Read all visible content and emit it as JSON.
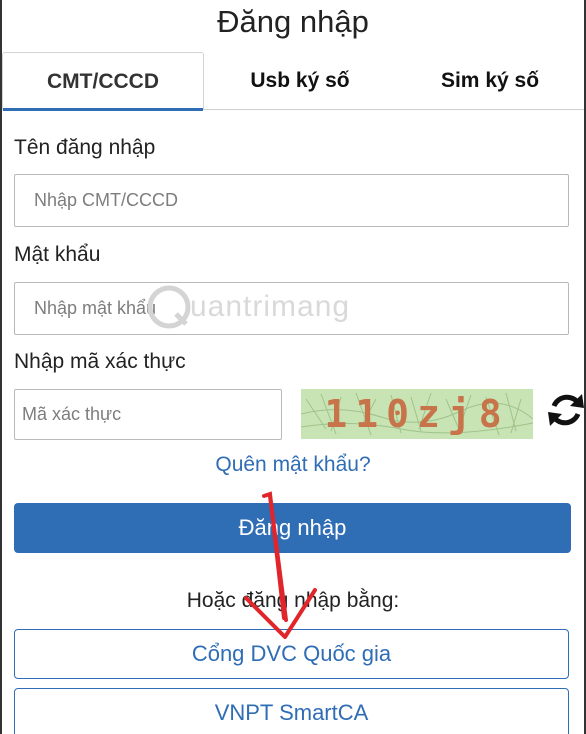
{
  "page": {
    "title": "Đăng nhập"
  },
  "tabs": [
    {
      "label": "CMT/CCCD",
      "active": true
    },
    {
      "label": "Usb ký số",
      "active": false
    },
    {
      "label": "Sim ký số",
      "active": false
    }
  ],
  "form": {
    "username_label": "Tên đăng nhập",
    "username_placeholder": "Nhập CMT/CCCD",
    "password_label": "Mật khẩu",
    "password_placeholder": "Nhập mật khẩu",
    "captcha_label": "Nhập mã xác thực",
    "captcha_placeholder": "Mã xác thực",
    "captcha_code": "110zj8",
    "forgot_link": "Quên mật khẩu?",
    "submit_label": "Đăng nhập"
  },
  "alternative": {
    "heading": "Hoặc đăng nhập bằng:",
    "options": [
      "Cổng DVC Quốc gia",
      "VNPT SmartCA"
    ]
  },
  "watermark": {
    "text": "uantrimang"
  },
  "colors": {
    "primary": "#2f6db5",
    "captcha_bg": "#c8e4b4",
    "captcha_text": "#c8744a",
    "annotation_arrow": "#e0262b"
  },
  "icons": {
    "refresh": "refresh-icon",
    "annotation": "red-arrow-annotation"
  }
}
